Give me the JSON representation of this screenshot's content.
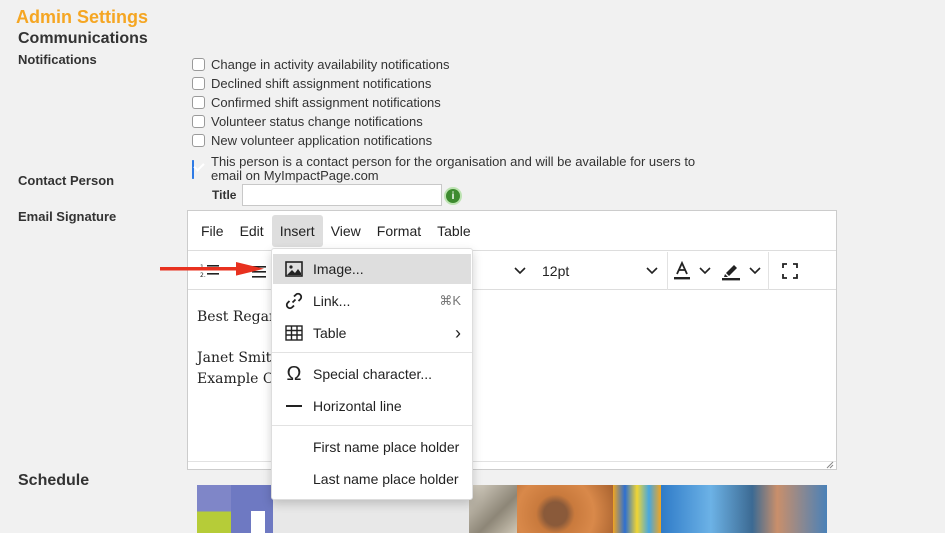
{
  "header": {
    "admin_title": "Admin Settings",
    "section_title": "Communications"
  },
  "notifications": {
    "label": "Notifications",
    "items": [
      {
        "label": "Change in activity availability notifications",
        "checked": false
      },
      {
        "label": "Declined shift assignment notifications",
        "checked": false
      },
      {
        "label": "Confirmed shift assignment notifications",
        "checked": false
      },
      {
        "label": "Volunteer status change notifications",
        "checked": false
      },
      {
        "label": "New volunteer application notifications",
        "checked": false
      }
    ]
  },
  "contact": {
    "label": "Contact Person",
    "checkbox_text": "This person is a contact person for the organisation and will be available for users to email on MyImpactPage.com",
    "checked": true,
    "title_label": "Title",
    "title_value": "",
    "info_icon": "i"
  },
  "signature": {
    "label": "Email Signature",
    "menubar": [
      "File",
      "Edit",
      "Insert",
      "View",
      "Format",
      "Table"
    ],
    "active_menu": "Insert",
    "toolbar": {
      "font_size": "12pt",
      "icons": [
        "numbered-list-icon",
        "bullet-list-icon",
        "chevron-down-icon",
        "text-color-icon",
        "highlight-icon",
        "fullscreen-icon"
      ]
    },
    "content": {
      "line1": "Best Regards,",
      "line2": "Janet Smith",
      "line3": "Example Company"
    }
  },
  "insert_menu": {
    "items": [
      {
        "label": "Image...",
        "icon": "image-icon",
        "shortcut": ""
      },
      {
        "label": "Link...",
        "icon": "link-icon",
        "shortcut": "⌘K"
      },
      {
        "label": "Table",
        "icon": "table-icon",
        "shortcut": "›"
      },
      {
        "label": "Special character...",
        "icon": "omega-icon",
        "shortcut": ""
      },
      {
        "label": "Horizontal line",
        "icon": "horizontal-line-icon",
        "shortcut": ""
      },
      {
        "label": "First name place holder",
        "icon": "",
        "shortcut": ""
      },
      {
        "label": "Last name place holder",
        "icon": "",
        "shortcut": ""
      }
    ]
  },
  "schedule": {
    "label": "Schedule"
  },
  "colors": {
    "admin_title": "#f5a623",
    "arrow": "#e8311f",
    "checkbox_checked": "#2f7be5",
    "info_icon": "#3d8b2f"
  }
}
